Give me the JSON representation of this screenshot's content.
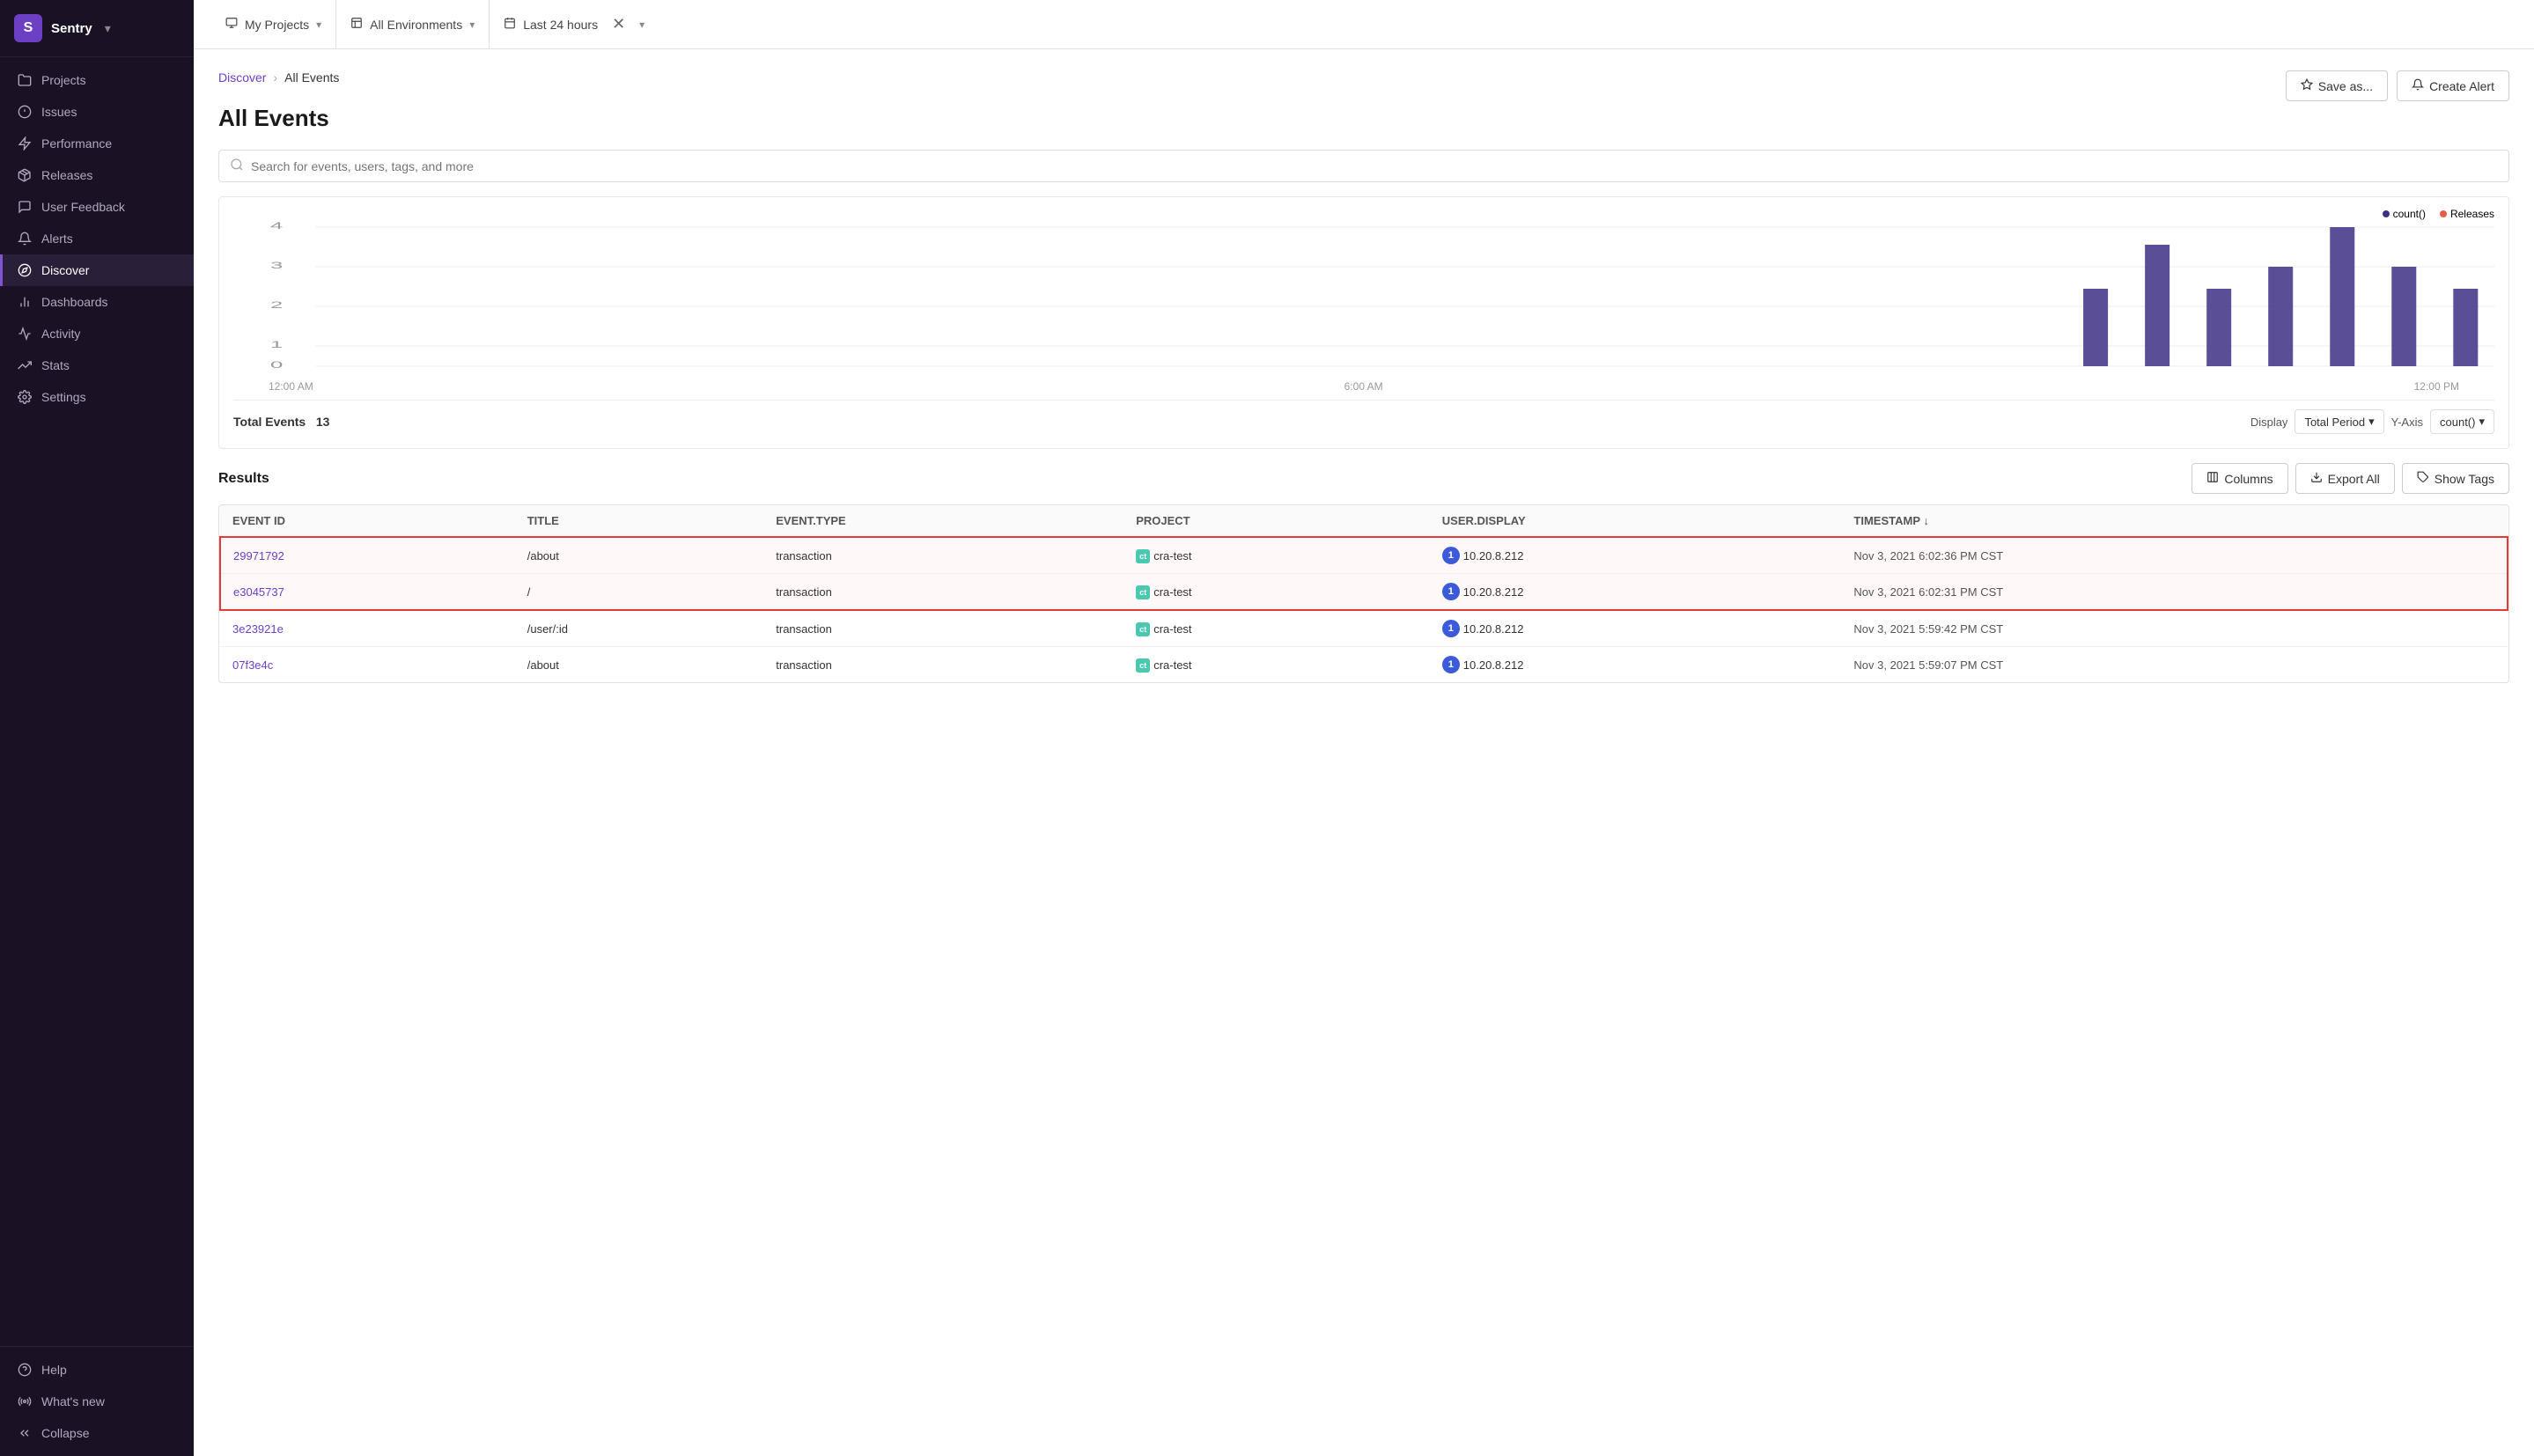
{
  "sidebar": {
    "logo": {
      "letter": "S",
      "name": "Sentry",
      "caret": "▾"
    },
    "items": [
      {
        "id": "projects",
        "label": "Projects",
        "icon": "folder"
      },
      {
        "id": "issues",
        "label": "Issues",
        "icon": "alert-circle"
      },
      {
        "id": "performance",
        "label": "Performance",
        "icon": "zap"
      },
      {
        "id": "releases",
        "label": "Releases",
        "icon": "package"
      },
      {
        "id": "user-feedback",
        "label": "User Feedback",
        "icon": "message-circle"
      },
      {
        "id": "alerts",
        "label": "Alerts",
        "icon": "bell"
      },
      {
        "id": "discover",
        "label": "Discover",
        "icon": "compass",
        "active": true
      },
      {
        "id": "dashboards",
        "label": "Dashboards",
        "icon": "bar-chart"
      },
      {
        "id": "activity",
        "label": "Activity",
        "icon": "activity"
      },
      {
        "id": "stats",
        "label": "Stats",
        "icon": "trending-up"
      },
      {
        "id": "settings",
        "label": "Settings",
        "icon": "settings"
      }
    ],
    "bottom_items": [
      {
        "id": "help",
        "label": "Help",
        "icon": "help-circle"
      },
      {
        "id": "whats-new",
        "label": "What's new",
        "icon": "radio"
      },
      {
        "id": "collapse",
        "label": "Collapse",
        "icon": "chevrons-left"
      }
    ]
  },
  "topbar": {
    "my_projects_label": "My Projects",
    "all_environments_label": "All Environments",
    "last_24_hours_label": "Last 24 hours"
  },
  "breadcrumb": {
    "parent": "Discover",
    "current": "All Events"
  },
  "page_title": "All Events",
  "buttons": {
    "save_as": "Save as...",
    "create_alert": "Create Alert"
  },
  "search": {
    "placeholder": "Search for events, users, tags, and more"
  },
  "chart": {
    "legend": [
      {
        "label": "count()",
        "color": "#3d2f85"
      },
      {
        "label": "Releases",
        "color": "#e85d4a"
      }
    ],
    "y_labels": [
      "4",
      "3",
      "2",
      "1",
      "0"
    ],
    "x_labels": [
      "12:00 AM",
      "6:00 AM",
      "12:00 PM"
    ],
    "total_events_label": "Total Events",
    "total_events_value": "13",
    "display_label": "Display",
    "total_period_label": "Total Period",
    "y_axis_label": "Y-Axis",
    "count_label": "count()"
  },
  "results": {
    "title": "Results",
    "columns_btn": "Columns",
    "export_btn": "Export All",
    "show_tags_btn": "Show Tags"
  },
  "table": {
    "columns": [
      "EVENT ID",
      "TITLE",
      "EVENT.TYPE",
      "PROJECT",
      "USER.DISPLAY",
      "TIMESTAMP ↓"
    ],
    "rows": [
      {
        "event_id": "29971792",
        "title": "/about",
        "event_type": "transaction",
        "project": "cra-test",
        "user_display": "10.20.8.212",
        "timestamp": "Nov 3, 2021 6:02:36 PM CST",
        "highlighted": true
      },
      {
        "event_id": "e3045737",
        "title": "/",
        "event_type": "transaction",
        "project": "cra-test",
        "user_display": "10.20.8.212",
        "timestamp": "Nov 3, 2021 6:02:31 PM CST",
        "highlighted": true
      },
      {
        "event_id": "3e23921e",
        "title": "/user/:id",
        "event_type": "transaction",
        "project": "cra-test",
        "user_display": "10.20.8.212",
        "timestamp": "Nov 3, 2021 5:59:42 PM CST",
        "highlighted": false
      },
      {
        "event_id": "07f3e4c",
        "title": "/about",
        "event_type": "transaction",
        "project": "cra-test",
        "user_display": "10.20.8.212",
        "timestamp": "Nov 3, 2021 5:59:07 PM CST",
        "highlighted": false
      }
    ]
  }
}
